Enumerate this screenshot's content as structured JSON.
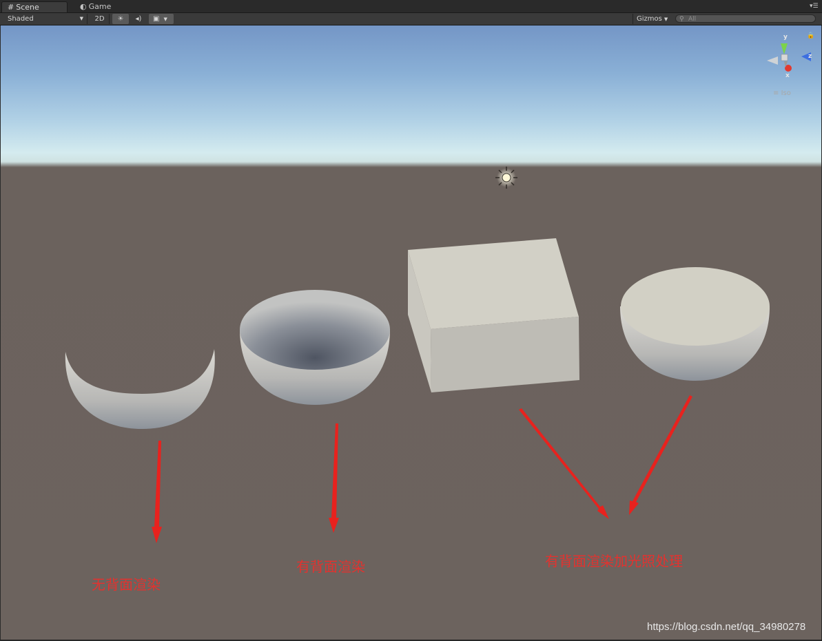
{
  "tabs": [
    {
      "label": "Scene",
      "icon": "grid-icon",
      "active": true
    },
    {
      "label": "Game",
      "icon": "pacman-icon",
      "active": false
    }
  ],
  "toolbar": {
    "shading_mode": "Shaded",
    "mode_2d": "2D",
    "gizmos_label": "Gizmos",
    "search_placeholder": "All"
  },
  "scene_gizmo": {
    "axis_y": "y",
    "axis_z": "z",
    "axis_x": "x",
    "projection": "Iso"
  },
  "annotations": {
    "label_left": "无背面渲染",
    "label_middle": "有背面渲染",
    "label_right": "有背面渲染加光照处理"
  },
  "watermark": "https://blog.csdn.net/qq_34980278",
  "colors": {
    "arrow_red": "#e3322f",
    "sky_top": "#7496c6",
    "ground": "#6c635e",
    "object": "#d4d1c8"
  }
}
